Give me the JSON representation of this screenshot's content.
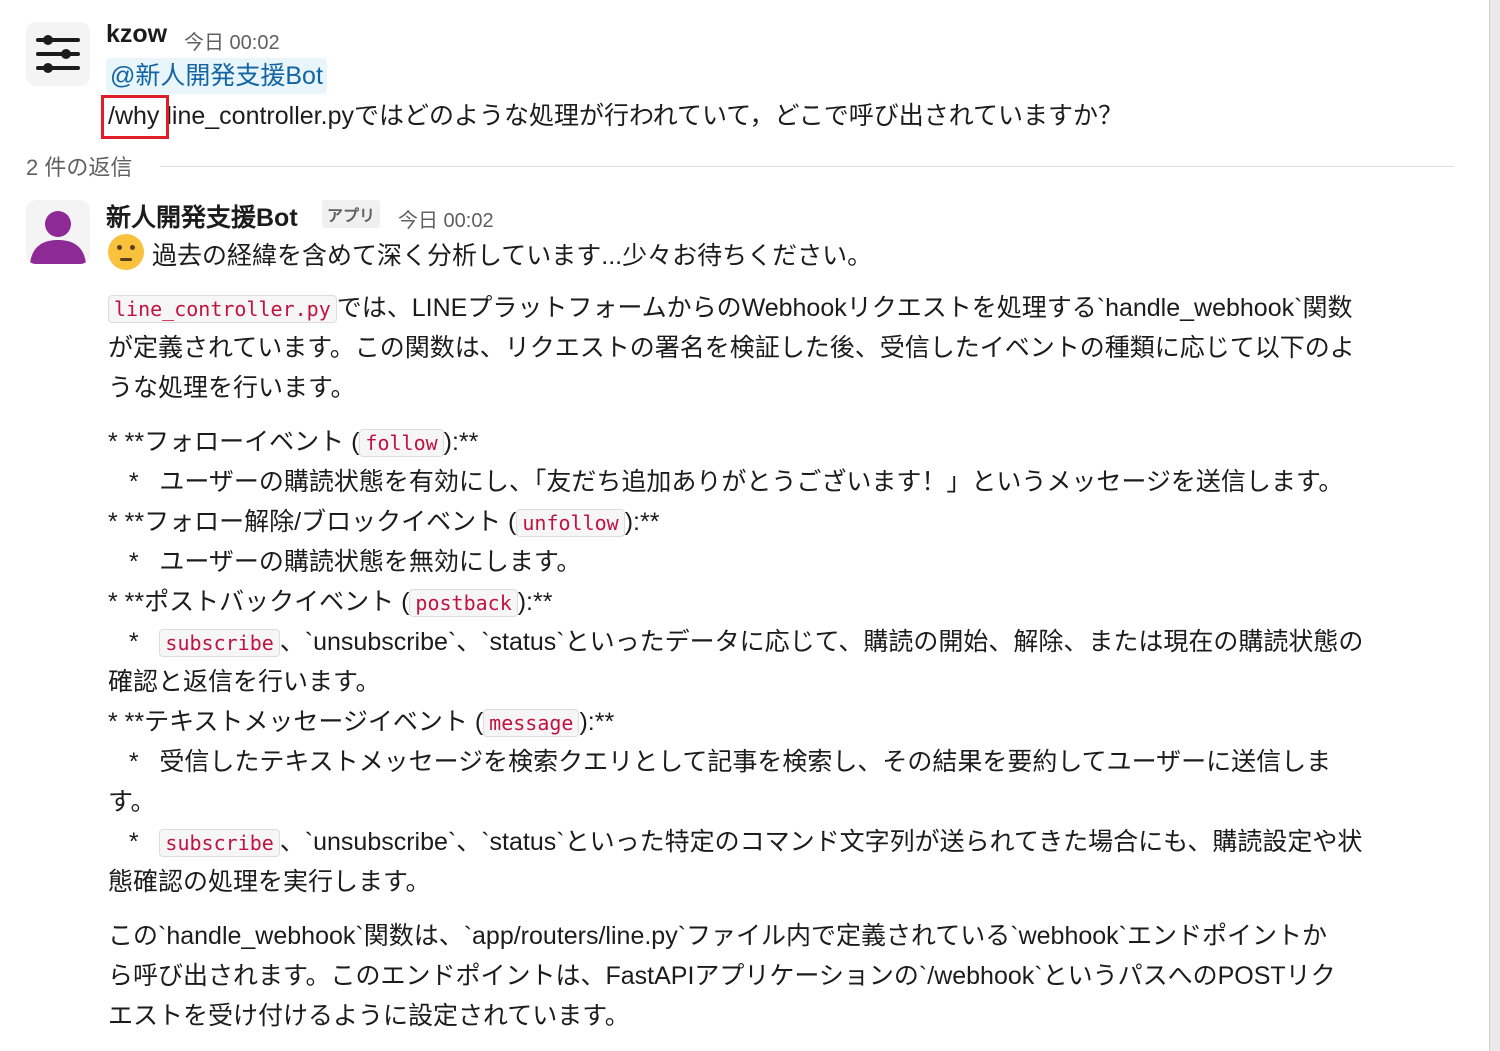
{
  "thread": {
    "question": {
      "author": "kzow",
      "time": "今日 00:02",
      "mention": "@新人開発支援Bot",
      "command": "/why",
      "text": "line_controller.pyではどのような処理が行われていて，どこで呼び出されていますか？"
    },
    "reply_count": "2 件の返信",
    "answer": {
      "author": "新人開発支援Bot",
      "badge": "アプリ",
      "time": "今日 00:02",
      "status": "過去の経緯を含めて深く分析しています...少々お待ちください。",
      "p1": {
        "code": "line_controller.py",
        "l1": "では、LINEプラットフォームからのWebhookリクエストを処理する`handle_webhook`関数",
        "l2": "が定義されています。この関数は、リクエストの署名を検証した後、受信したイベントの種類に応じて以下のよ",
        "l3": "うな処理を行います。"
      },
      "bullets": {
        "b1_pre": "*   **フォローイベント (",
        "b1_code": "follow",
        "b1_post": "):**",
        "b1_sub": "   *   ユーザーの購読状態を有効にし、「友だち追加ありがとうございます！」というメッセージを送信します。",
        "b2_pre": "*   **フォロー解除/ブロックイベント (",
        "b2_code": "unfollow",
        "b2_post": "):**",
        "b2_sub": "   *   ユーザーの購読状態を無効にします。",
        "b3_pre": "*   **ポストバックイベント (",
        "b3_code": "postback",
        "b3_post": "):**",
        "b3_sub_pre": "   *   ",
        "b3_sub_code": "subscribe",
        "b3_sub_l1": "、`unsubscribe`、`status`といったデータに応じて、購読の開始、解除、または現在の購読状態の",
        "b3_sub_l2": "確認と返信を行います。",
        "b4_pre": "*   **テキストメッセージイベント (",
        "b4_code": "message",
        "b4_post": "):**",
        "b4_sub1_l1": "   *   受信したテキストメッセージを検索クエリとして記事を検索し、その結果を要約してユーザーに送信しま",
        "b4_sub1_l2": "す。",
        "b4_sub2_pre": "   *   ",
        "b4_sub2_code": "subscribe",
        "b4_sub2_l1": "、`unsubscribe`、`status`といった特定のコマンド文字列が送られてきた場合にも、購読設定や状",
        "b4_sub2_l2": "態確認の処理を実行します。"
      },
      "p2": {
        "l1": "この`handle_webhook`関数は、`app/routers/line.py`ファイル内で定義されている`webhook`エンドポイントか",
        "l2": "ら呼び出されます。このエンドポイントは、FastAPIアプリケーションの`/webhook`というパスへのPOSTリク",
        "l3": "エストを受け付けるように設定されています。"
      }
    }
  },
  "icons": {
    "kzow_avatar": "sliders-icon",
    "bot_avatar": "user-silhouette-icon",
    "emoji": "thinking-face-icon"
  },
  "colors": {
    "mention": "#1264a3",
    "code": "#c01343",
    "highlight_box": "#e01e2a",
    "bot_avatar": "#8e2a96"
  }
}
